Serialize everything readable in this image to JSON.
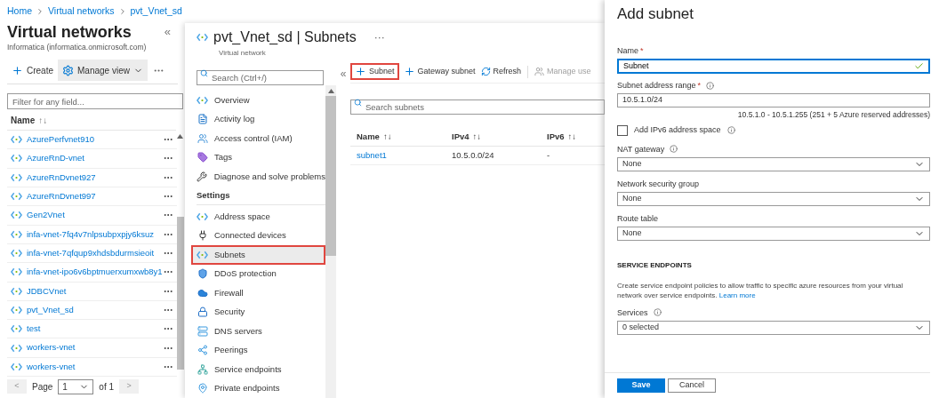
{
  "breadcrumb": [
    "Home",
    "Virtual networks",
    "pvt_Vnet_sd"
  ],
  "list_blade": {
    "title": "Virtual networks",
    "subtitle": "Informatica (informatica.onmicrosoft.com)",
    "collapse": "«",
    "toolbar": [
      {
        "label": "Create",
        "kind": "add",
        "selected": false
      },
      {
        "label": "Manage view",
        "kind": "gear",
        "selected": true
      }
    ],
    "filter": {
      "placeholder": "Filter for any field..."
    },
    "column": {
      "label": "Name",
      "sort": "↑↓"
    },
    "rows": [
      {
        "name": "AzurePerfvnet910"
      },
      {
        "name": "AzureRnD-vnet"
      },
      {
        "name": "AzureRnDvnet927"
      },
      {
        "name": "AzureRnDvnet997"
      },
      {
        "name": "Gen2Vnet"
      },
      {
        "name": "infa-vnet-7fq4v7nlpsubpxpjy6ksuz"
      },
      {
        "name": "infa-vnet-7qfqup9xhdsbdurmsieoit"
      },
      {
        "name": "infa-vnet-ipo6v6bptmuerxumxwb8y1"
      },
      {
        "name": "JDBCVnet"
      },
      {
        "name": "pvt_Vnet_sd"
      },
      {
        "name": "test"
      },
      {
        "name": "workers-vnet"
      },
      {
        "name": "workers-vnet"
      }
    ],
    "pager": {
      "prev": "<",
      "label": "Page",
      "page": "1",
      "of": "of 1",
      "next": ">"
    }
  },
  "resource_blade": {
    "title": "pvt_Vnet_sd | Subnets",
    "more": "···",
    "subtitle": "Virtual network",
    "search": {
      "placeholder": "Search (Ctrl+/)"
    },
    "collapse": "«",
    "menu": [
      {
        "label": "Overview",
        "kind": "vnet",
        "selected": false,
        "highlighted": false
      },
      {
        "label": "Activity log",
        "kind": "log",
        "selected": false,
        "highlighted": false
      },
      {
        "label": "Access control (IAM)",
        "kind": "people",
        "selected": false,
        "highlighted": false
      },
      {
        "label": "Tags",
        "kind": "tag",
        "selected": false,
        "highlighted": false
      },
      {
        "label": "Diagnose and solve problems",
        "kind": "wrench",
        "selected": false,
        "highlighted": false
      }
    ],
    "settings": {
      "label": "Settings",
      "items": [
        {
          "label": "Address space",
          "kind": "vnet",
          "selected": false,
          "highlighted": false
        },
        {
          "label": "Connected devices",
          "kind": "plug",
          "selected": false,
          "highlighted": false
        },
        {
          "label": "Subnets",
          "kind": "vnet",
          "selected": true,
          "highlighted": true
        },
        {
          "label": "DDoS protection",
          "kind": "shield",
          "selected": false,
          "highlighted": false
        },
        {
          "label": "Firewall",
          "kind": "firewall",
          "selected": false,
          "highlighted": false
        },
        {
          "label": "Security",
          "kind": "lock",
          "selected": false,
          "highlighted": false
        },
        {
          "label": "DNS servers",
          "kind": "dns",
          "selected": false,
          "highlighted": false
        },
        {
          "label": "Peerings",
          "kind": "peer",
          "selected": false,
          "highlighted": false
        },
        {
          "label": "Service endpoints",
          "kind": "endpoint",
          "selected": false,
          "highlighted": false
        },
        {
          "label": "Private endpoints",
          "kind": "private",
          "selected": false,
          "highlighted": false
        }
      ]
    },
    "toolbar": [
      {
        "label": "Subnet",
        "kind": "add",
        "highlighted": true,
        "disabled": false
      },
      {
        "label": "Gateway subnet",
        "kind": "add",
        "highlighted": false,
        "disabled": false
      },
      {
        "label": "Refresh",
        "kind": "refresh",
        "highlighted": false,
        "disabled": false
      },
      {
        "label": "Manage use",
        "kind": "people",
        "highlighted": false,
        "disabled": true
      }
    ],
    "table_search": {
      "placeholder": "Search subnets"
    },
    "columns": [
      {
        "label": "Name",
        "sort": "↑↓"
      },
      {
        "label": "IPv4",
        "sort": "↑↓"
      },
      {
        "label": "IPv6",
        "sort": "↑↓"
      }
    ],
    "rows": [
      [
        "subnet1",
        "10.5.0.0/24",
        "-"
      ]
    ]
  },
  "add_subnet": {
    "title": "Add subnet",
    "name": {
      "label": "Name",
      "required": "*",
      "value": "Subnet",
      "valid": true
    },
    "range": {
      "label": "Subnet address range",
      "required": "*",
      "value": "10.5.1.0/24",
      "hint": "10.5.1.0 - 10.5.1.255 (251 + 5 Azure reserved addresses)"
    },
    "ipv6": {
      "label": "Add IPv6 address space",
      "checked": false
    },
    "selects": [
      {
        "label": "NAT gateway",
        "info": true,
        "value": "None"
      },
      {
        "label": "Network security group",
        "info": false,
        "value": "None"
      },
      {
        "label": "Route table",
        "info": false,
        "value": "None"
      }
    ],
    "section": "SERVICE ENDPOINTS",
    "description": "Create service endpoint policies to allow traffic to specific azure resources from your virtual network over service endpoints.",
    "learn_more": "Learn more",
    "services": {
      "label": "Services",
      "info": true,
      "value": "0 selected"
    },
    "buttons": [
      {
        "label": "Save",
        "primary": true
      },
      {
        "label": "Cancel",
        "primary": false
      }
    ]
  }
}
